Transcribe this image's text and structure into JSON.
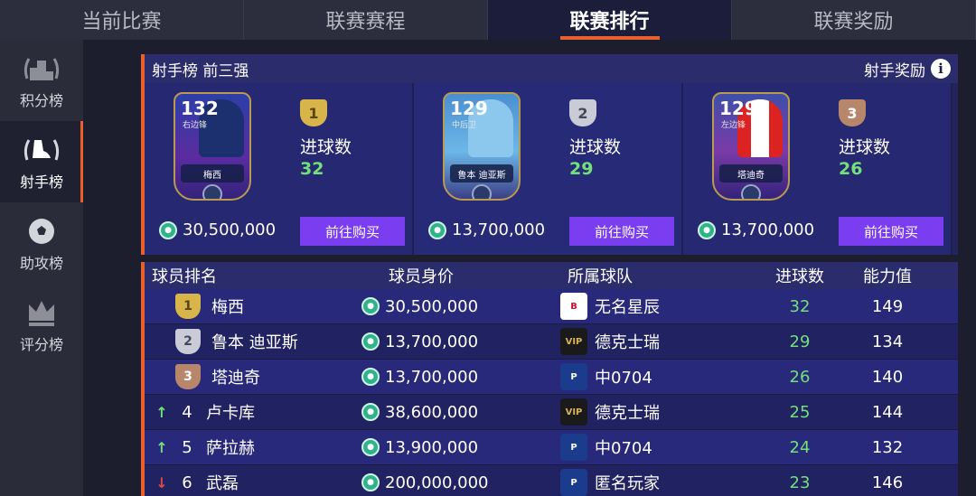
{
  "top_tabs": [
    "当前比赛",
    "联赛赛程",
    "联赛排行",
    "联赛奖励"
  ],
  "sidebar": [
    {
      "label": "积分榜",
      "icon": "podium-icon"
    },
    {
      "label": "射手榜",
      "icon": "boot-icon"
    },
    {
      "label": "助攻榜",
      "icon": "ball-icon"
    },
    {
      "label": "评分榜",
      "icon": "crown-icon"
    }
  ],
  "panel": {
    "title": "射手榜 前三强",
    "reward_link": "射手奖励",
    "goals_label": "进球数",
    "buy_label": "前往购买"
  },
  "top3": [
    {
      "rank": "1",
      "rating": "132",
      "position": "右边锋",
      "card_name": "梅西",
      "goals": "32",
      "price": "30,500,000"
    },
    {
      "rank": "2",
      "rating": "129",
      "position": "中后卫",
      "card_name": "鲁本 迪亚斯",
      "goals": "29",
      "price": "13,700,000"
    },
    {
      "rank": "3",
      "rating": "129",
      "position": "左边锋",
      "card_name": "塔迪奇",
      "goals": "26",
      "price": "13,700,000"
    }
  ],
  "table": {
    "headers": {
      "player": "球员排名",
      "value": "球员身价",
      "team": "所属球队",
      "goals": "进球数",
      "ability": "能力值"
    },
    "rows": [
      {
        "rank": "1",
        "trend": "",
        "name": "梅西",
        "price": "30,500,000",
        "team": "无名星辰",
        "crest": "bayern",
        "goals": "32",
        "ability": "149"
      },
      {
        "rank": "2",
        "trend": "",
        "name": "鲁本 迪亚斯",
        "price": "13,700,000",
        "team": "德克士瑞",
        "crest": "vip",
        "goals": "29",
        "ability": "134"
      },
      {
        "rank": "3",
        "trend": "",
        "name": "塔迪奇",
        "price": "13,700,000",
        "team": "中0704",
        "crest": "psg",
        "goals": "26",
        "ability": "140"
      },
      {
        "rank": "4",
        "trend": "up",
        "name": "卢卡库",
        "price": "38,600,000",
        "team": "德克士瑞",
        "crest": "vip",
        "goals": "25",
        "ability": "144"
      },
      {
        "rank": "5",
        "trend": "up",
        "name": "萨拉赫",
        "price": "13,900,000",
        "team": "中0704",
        "crest": "psg",
        "goals": "24",
        "ability": "132"
      },
      {
        "rank": "6",
        "trend": "down",
        "name": "武磊",
        "price": "200,000,000",
        "team": "匿名玩家",
        "crest": "psg",
        "goals": "23",
        "ability": "146"
      }
    ]
  },
  "colors": {
    "accent": "#e8612c",
    "goals": "#74e07a",
    "buy": "#7a3df0",
    "gold": "#d8b54a",
    "silver": "#c9ccd6",
    "bronze": "#b8866a"
  }
}
